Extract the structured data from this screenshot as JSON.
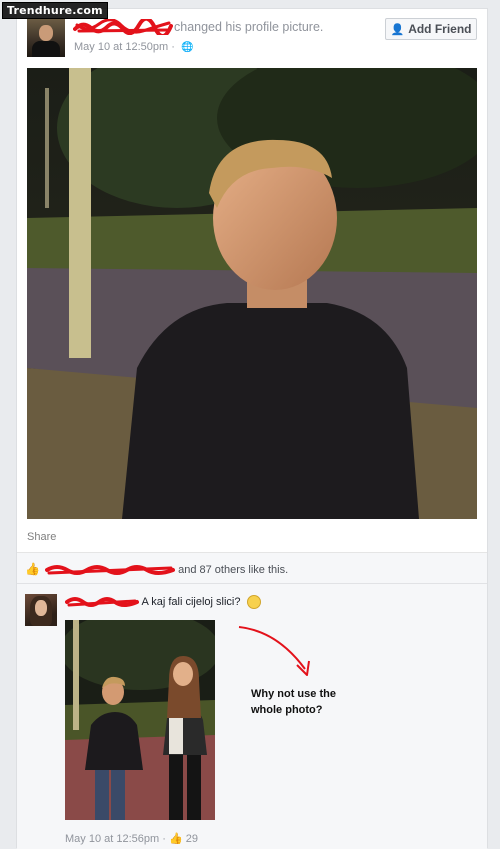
{
  "watermark": "Trendhure.com",
  "post": {
    "action_text": "changed his profile picture.",
    "timestamp": "May 10 at 12:50pm",
    "separator": "·",
    "privacy_icon": "globe-icon",
    "add_friend_label": "Add Friend",
    "share_label": "Share"
  },
  "likes": {
    "text": "and 87 others like this."
  },
  "comment": {
    "text": "A kaj fali cijeloj slici?",
    "emoji": "grinning-face-icon",
    "annotation_line1": "Why not use the",
    "annotation_line2": "whole photo?",
    "timestamp": "May 10 at 12:56pm",
    "separator": "·",
    "like_count": "29"
  },
  "colors": {
    "redaction": "#e3121b",
    "annotation_arrow": "#e3121b",
    "link_blue": "#4267b2",
    "meta_gray": "#90949c"
  }
}
